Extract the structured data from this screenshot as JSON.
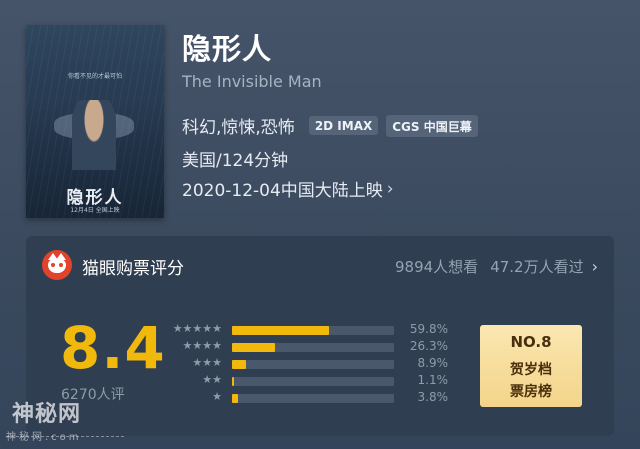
{
  "movie": {
    "title": "隐形人",
    "original_title": "The Invisible Man",
    "genres": "科幻,惊悚,恐怖",
    "tags": [
      "2D IMAX",
      "CGS 中国巨幕"
    ],
    "country_duration": "美国/124分钟",
    "release": "2020-12-04中国大陆上映",
    "poster": {
      "tagline": "你看不见的才最可怕",
      "title": "隐形人",
      "date": "12月4日 全国上映"
    }
  },
  "rating": {
    "brand": "猫眼购票评分",
    "want_to_see": "9894人想看",
    "watched": "47.2万人看过",
    "score": "8.4",
    "raters": "6270人评",
    "distribution": [
      {
        "stars": "★★★★★",
        "percent_label": "59.8%",
        "fraction": 0.598
      },
      {
        "stars": "★★★★",
        "percent_label": "26.3%",
        "fraction": 0.263
      },
      {
        "stars": "★★★",
        "percent_label": "8.9%",
        "fraction": 0.089
      },
      {
        "stars": "★★",
        "percent_label": "1.1%",
        "fraction": 0.011
      },
      {
        "stars": "★",
        "percent_label": "3.8%",
        "fraction": 0.038
      }
    ],
    "rank_badge": {
      "no": "NO.8",
      "line1": "贺岁档",
      "line2": "票房榜"
    }
  },
  "watermark": {
    "text": "神秘网",
    "subtext": "神秘网.com"
  },
  "colors": {
    "accent": "#f2b90d",
    "card": "#303e51",
    "logo": "#e2432c"
  }
}
